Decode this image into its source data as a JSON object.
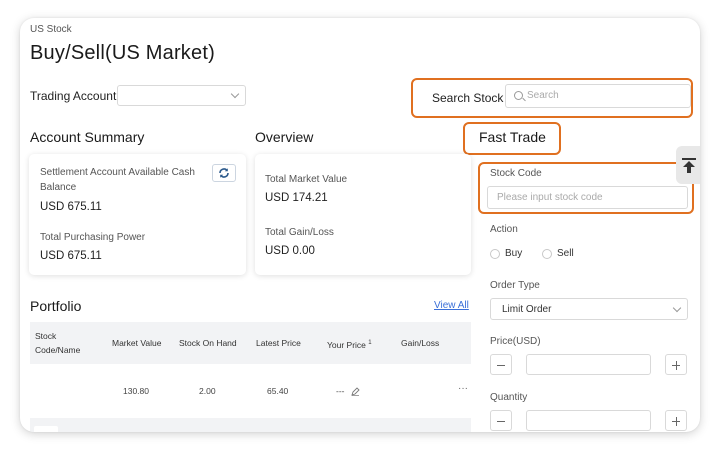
{
  "breadcrumb": "US Stock",
  "page_title": "Buy/Sell(US Market)",
  "trading_account": {
    "label": "Trading Account",
    "value": ""
  },
  "search": {
    "label": "Search Stock",
    "placeholder": "Search"
  },
  "account_summary": {
    "title": "Account Summary",
    "cash_label": "Settlement Account Available Cash Balance",
    "cash_value": "USD 675.11",
    "power_label": "Total Purchasing Power",
    "power_value": "USD 675.11"
  },
  "overview": {
    "title": "Overview",
    "market_value_label": "Total Market Value",
    "market_value": "USD 174.21",
    "gain_loss_label": "Total Gain/Loss",
    "gain_loss_value": "USD 0.00"
  },
  "portfolio": {
    "title": "Portfolio",
    "view_all": "View All",
    "columns": {
      "stock_code": "Stock Code/Name",
      "market_value": "Market Value",
      "on_hand": "Stock On Hand",
      "latest_price": "Latest Price",
      "your_price": "Your Price",
      "your_price_sup": "1",
      "gain_loss": "Gain/Loss"
    },
    "rows": [
      {
        "stock": "",
        "market_value": "130.80",
        "on_hand": "2.00",
        "latest_price": "65.40",
        "your_price": "---",
        "gain_loss": "",
        "more": "···"
      }
    ]
  },
  "fast_trade": {
    "title": "Fast Trade",
    "stock_code_label": "Stock Code",
    "stock_code_placeholder": "Please input stock code",
    "action_label": "Action",
    "buy": "Buy",
    "sell": "Sell",
    "order_type_label": "Order Type",
    "order_type_value": "Limit Order",
    "price_label": "Price(USD)",
    "price_value": "",
    "quantity_label": "Quantity",
    "quantity_value": ""
  },
  "icons": {
    "refresh": "refresh-icon",
    "search": "search-icon",
    "chevron": "chevron-down-icon",
    "back_to_top": "back-to-top-icon",
    "edit": "pencil-icon"
  },
  "colors": {
    "highlight": "#e07020",
    "link": "#3a6fd8",
    "refresh_icon": "#2c5a8c"
  }
}
